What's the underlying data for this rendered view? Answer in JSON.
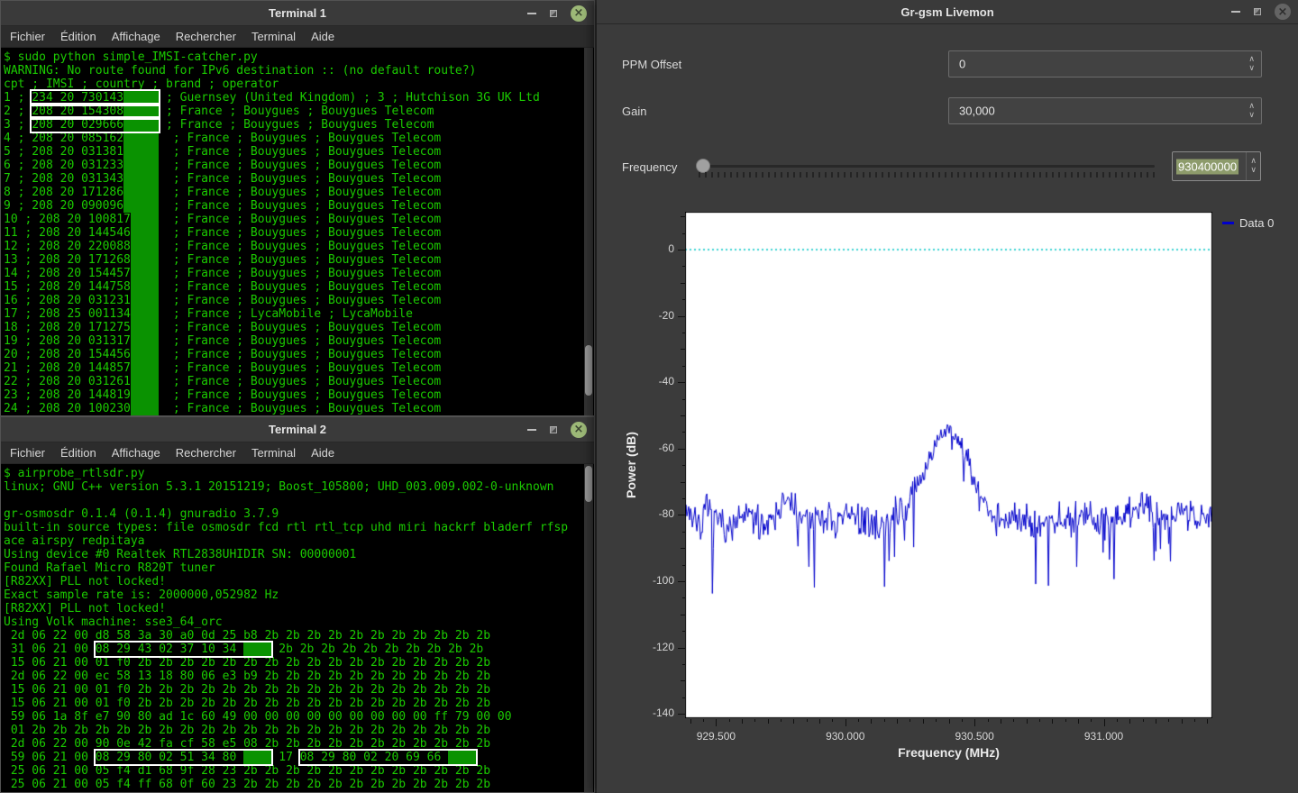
{
  "terminal1": {
    "title": "Terminal 1",
    "menu": [
      "Fichier",
      "Édition",
      "Affichage",
      "Rechercher",
      "Terminal",
      "Aide"
    ],
    "lines": [
      [
        {
          "t": "$ sudo python simple_IMSI-catcher.py"
        }
      ],
      [
        {
          "t": "WARNING: No route found for IPv6 destination :: (no default route?)"
        }
      ],
      [
        {
          "t": "cpt ; IMSI ; country ; brand ; operator"
        }
      ],
      [
        {
          "t": "1 ; "
        },
        {
          "box": [
            {
              "t": "234 20 730143"
            },
            {
              "b": 5
            }
          ]
        },
        {
          "t": " ; Guernsey (United Kingdom) ; 3 ; Hutchison 3G UK Ltd"
        }
      ],
      [
        {
          "t": "2 ; "
        },
        {
          "box": [
            {
              "t": "208 20 154308"
            },
            {
              "b": 5
            }
          ]
        },
        {
          "t": " ; France ; Bouygues ; Bouygues Telecom"
        }
      ],
      [
        {
          "t": "3 ; "
        },
        {
          "box": [
            {
              "t": "208 20 029666"
            },
            {
              "b": 5
            }
          ]
        },
        {
          "t": " ; France ; Bouygues ; Bouygues Telecom"
        }
      ],
      [
        {
          "t": "4 ; 208 20 085162"
        },
        {
          "b": 5
        },
        {
          "t": "  ; France ; Bouygues ; Bouygues Telecom"
        }
      ],
      [
        {
          "t": "5 ; 208 20 031381"
        },
        {
          "b": 5
        },
        {
          "t": "  ; France ; Bouygues ; Bouygues Telecom"
        }
      ],
      [
        {
          "t": "6 ; 208 20 031233"
        },
        {
          "b": 5
        },
        {
          "t": "  ; France ; Bouygues ; Bouygues Telecom"
        }
      ],
      [
        {
          "t": "7 ; 208 20 031343"
        },
        {
          "b": 5
        },
        {
          "t": "  ; France ; Bouygues ; Bouygues Telecom"
        }
      ],
      [
        {
          "t": "8 ; 208 20 171286"
        },
        {
          "b": 5
        },
        {
          "t": "  ; France ; Bouygues ; Bouygues Telecom"
        }
      ],
      [
        {
          "t": "9 ; 208 20 090096"
        },
        {
          "b": 5
        },
        {
          "t": "  ; France ; Bouygues ; Bouygues Telecom"
        }
      ],
      [
        {
          "t": "10 ; 208 20 100817"
        },
        {
          "b": 4
        },
        {
          "t": "  ; France ; Bouygues ; Bouygues Telecom"
        }
      ],
      [
        {
          "t": "11 ; 208 20 144546"
        },
        {
          "b": 4
        },
        {
          "t": "  ; France ; Bouygues ; Bouygues Telecom"
        }
      ],
      [
        {
          "t": "12 ; 208 20 220088"
        },
        {
          "b": 4
        },
        {
          "t": "  ; France ; Bouygues ; Bouygues Telecom"
        }
      ],
      [
        {
          "t": "13 ; 208 20 171268"
        },
        {
          "b": 4
        },
        {
          "t": "  ; France ; Bouygues ; Bouygues Telecom"
        }
      ],
      [
        {
          "t": "14 ; 208 20 154457"
        },
        {
          "b": 4
        },
        {
          "t": "  ; France ; Bouygues ; Bouygues Telecom"
        }
      ],
      [
        {
          "t": "15 ; 208 20 144758"
        },
        {
          "b": 4
        },
        {
          "t": "  ; France ; Bouygues ; Bouygues Telecom"
        }
      ],
      [
        {
          "t": "16 ; 208 20 031231"
        },
        {
          "b": 4
        },
        {
          "t": "  ; France ; Bouygues ; Bouygues Telecom"
        }
      ],
      [
        {
          "t": "17 ; 208 25 001134"
        },
        {
          "b": 4
        },
        {
          "t": "  ; France ; LycaMobile ; LycaMobile"
        }
      ],
      [
        {
          "t": "18 ; 208 20 171275"
        },
        {
          "b": 4
        },
        {
          "t": "  ; France ; Bouygues ; Bouygues Telecom"
        }
      ],
      [
        {
          "t": "19 ; 208 20 031317"
        },
        {
          "b": 4
        },
        {
          "t": "  ; France ; Bouygues ; Bouygues Telecom"
        }
      ],
      [
        {
          "t": "20 ; 208 20 154456"
        },
        {
          "b": 4
        },
        {
          "t": "  ; France ; Bouygues ; Bouygues Telecom"
        }
      ],
      [
        {
          "t": "21 ; 208 20 144857"
        },
        {
          "b": 4
        },
        {
          "t": "  ; France ; Bouygues ; Bouygues Telecom"
        }
      ],
      [
        {
          "t": "22 ; 208 20 031261"
        },
        {
          "b": 4
        },
        {
          "t": "  ; France ; Bouygues ; Bouygues Telecom"
        }
      ],
      [
        {
          "t": "23 ; 208 20 144819"
        },
        {
          "b": 4
        },
        {
          "t": "  ; France ; Bouygues ; Bouygues Telecom"
        }
      ],
      [
        {
          "t": "24 ; 208 20 100230"
        },
        {
          "b": 4
        },
        {
          "t": "  ; France ; Bouygues ; Bouygues Telecom"
        }
      ]
    ]
  },
  "terminal2": {
    "title": "Terminal 2",
    "menu": [
      "Fichier",
      "Édition",
      "Affichage",
      "Rechercher",
      "Terminal",
      "Aide"
    ],
    "lines": [
      [
        {
          "t": "$ airprobe_rtlsdr.py"
        }
      ],
      [
        {
          "t": "linux; GNU C++ version 5.3.1 20151219; Boost_105800; UHD_003.009.002-0-unknown"
        }
      ],
      [
        {
          "t": ""
        }
      ],
      [
        {
          "t": "gr-osmosdr 0.1.4 (0.1.4) gnuradio 3.7.9"
        }
      ],
      [
        {
          "t": "built-in source types: file osmosdr fcd rtl rtl_tcp uhd miri hackrf bladerf rfsp"
        }
      ],
      [
        {
          "t": "ace airspy redpitaya"
        }
      ],
      [
        {
          "t": "Using device #0 Realtek RTL2838UHIDIR SN: 00000001"
        }
      ],
      [
        {
          "t": "Found Rafael Micro R820T tuner"
        }
      ],
      [
        {
          "t": "[R82XX] PLL not locked!"
        }
      ],
      [
        {
          "t": "Exact sample rate is: 2000000,052982 Hz"
        }
      ],
      [
        {
          "t": "[R82XX] PLL not locked!"
        }
      ],
      [
        {
          "t": "Using Volk machine: sse3_64_orc"
        }
      ],
      [
        {
          "t": " 2d 06 22 00 d8 58 3a 30 a0 0d 25 b8 2b 2b 2b 2b 2b 2b 2b 2b 2b 2b 2b"
        }
      ],
      [
        {
          "t": " 31 06 21 00 "
        },
        {
          "box": [
            {
              "t": "08 29 43 02 37 10 34 "
            },
            {
              "b": 4
            }
          ]
        },
        {
          "t": " 2b 2b 2b 2b 2b 2b 2b 2b 2b 2b"
        }
      ],
      [
        {
          "t": " 15 06 21 00 01 f0 2b 2b 2b 2b 2b 2b 2b 2b 2b 2b 2b 2b 2b 2b 2b 2b 2b"
        }
      ],
      [
        {
          "t": " 2d 06 22 00 ec 58 13 18 80 06 e3 b9 2b 2b 2b 2b 2b 2b 2b 2b 2b 2b 2b"
        }
      ],
      [
        {
          "t": " 15 06 21 00 01 f0 2b 2b 2b 2b 2b 2b 2b 2b 2b 2b 2b 2b 2b 2b 2b 2b 2b"
        }
      ],
      [
        {
          "t": " 15 06 21 00 01 f0 2b 2b 2b 2b 2b 2b 2b 2b 2b 2b 2b 2b 2b 2b 2b 2b 2b"
        }
      ],
      [
        {
          "t": " 59 06 1a 8f e7 90 80 ad 1c 60 49 00 00 00 00 00 00 00 00 00 ff 79 00 00"
        }
      ],
      [
        {
          "t": " 01 2b 2b 2b 2b 2b 2b 2b 2b 2b 2b 2b 2b 2b 2b 2b 2b 2b 2b 2b 2b 2b 2b"
        }
      ],
      [
        {
          "t": " 2d 06 22 00 90 0e 42 fa cf 58 e5 08 2b 2b 2b 2b 2b 2b 2b 2b 2b 2b 2b"
        }
      ],
      [
        {
          "t": " 59 06 21 00 "
        },
        {
          "box": [
            {
              "t": "08 29 80 02 51 34 80 "
            },
            {
              "b": 4
            }
          ]
        },
        {
          "t": " 17 "
        },
        {
          "box": [
            {
              "t": "08 29 80 02 20 69 66 "
            },
            {
              "b": 4
            }
          ]
        }
      ],
      [
        {
          "t": " 25 06 21 00 05 f4 d1 68 9f 28 23 2b 2b 2b 2b 2b 2b 2b 2b 2b 2b 2b 2b"
        }
      ],
      [
        {
          "t": " 25 06 21 00 05 f4 ff 68 0f 60 23 2b 2b 2b 2b 2b 2b 2b 2b 2b 2b 2b 2b"
        }
      ]
    ]
  },
  "livemon": {
    "title": "Gr-gsm Livemon",
    "controls": {
      "ppm_label": "PPM Offset",
      "ppm_value": "0",
      "gain_label": "Gain",
      "gain_value": "30,000",
      "freq_label": "Frequency",
      "freq_value": "930400000"
    },
    "colors": {
      "trace": "#0000cc",
      "zero_line": "#00c8c8",
      "freq_selection": "#8d9b6b",
      "terminal_green": "#1bcb01"
    }
  },
  "chart_data": {
    "type": "line",
    "title": "",
    "xlabel": "Frequency (MHz)",
    "ylabel": "Power (dB)",
    "xlim": [
      929.38,
      931.42
    ],
    "ylim": [
      -141.3,
      11.4
    ],
    "grid": false,
    "legend_position": "top-right",
    "legend": [
      {
        "label": "Data 0",
        "color": "#0000cc"
      }
    ],
    "x_major_ticks": [
      929.5,
      930.0,
      930.5,
      931.0
    ],
    "x_tick_labels": [
      "929.500",
      "930.000",
      "930.500",
      "931.000"
    ],
    "x_minor_step": 0.05,
    "y_major_ticks": [
      0,
      -20,
      -40,
      -60,
      -80,
      -100,
      -120,
      -140
    ],
    "y_minor_step": 5,
    "reference_line_y": 0,
    "series": [
      {
        "name": "Data 0",
        "color": "#0000cc",
        "noise_floor_db": -80,
        "peak_center_mhz": 930.4,
        "peak_top_db": -54,
        "anchors_x": [
          929.38,
          929.44,
          929.46,
          929.5,
          929.56,
          929.62,
          929.68,
          929.74,
          929.78,
          929.84,
          929.9,
          929.96,
          930.02,
          930.08,
          930.14,
          930.18,
          930.22,
          930.26,
          930.3,
          930.34,
          930.38,
          930.4,
          930.42,
          930.44,
          930.47,
          930.5,
          930.53,
          930.57,
          930.62,
          930.68,
          930.74,
          930.8,
          930.86,
          930.92,
          930.98,
          931.04,
          931.1,
          931.16,
          931.22,
          931.28,
          931.34,
          931.42
        ],
        "anchors_y": [
          -78,
          -83,
          -79,
          -81,
          -84,
          -80,
          -83,
          -78,
          -76,
          -82,
          -80,
          -83,
          -80,
          -82,
          -84,
          -80,
          -78,
          -74,
          -68,
          -60,
          -56,
          -54,
          -56,
          -58,
          -63,
          -70,
          -76,
          -80,
          -82,
          -80,
          -83,
          -80,
          -82,
          -79,
          -81,
          -83,
          -79,
          -77,
          -80,
          -78,
          -81,
          -79
        ],
        "noise_db": 6,
        "spike_prob": 0.05,
        "spike_extra_db": 20,
        "points": 580,
        "seed": 7
      }
    ]
  }
}
